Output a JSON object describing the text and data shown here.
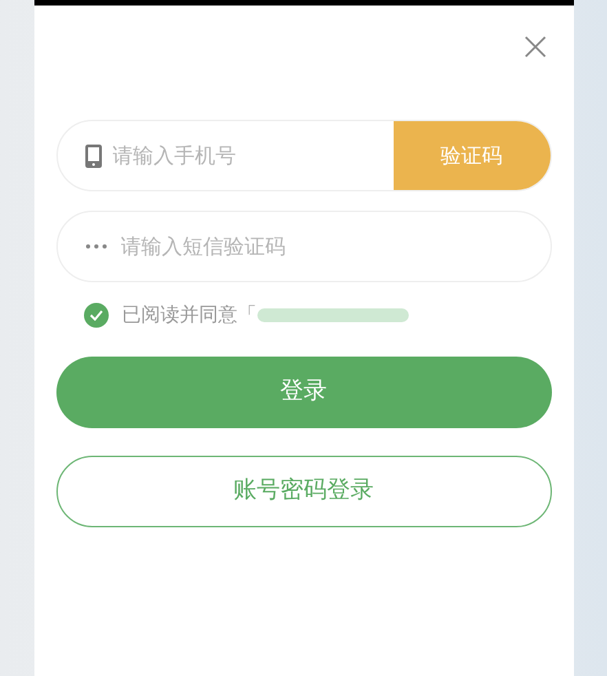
{
  "phone_field": {
    "placeholder": "请输入手机号"
  },
  "code_button": {
    "label": "验证码"
  },
  "sms_field": {
    "placeholder": "请输入短信验证码"
  },
  "agreement": {
    "checked": true,
    "text": "已阅读并同意「"
  },
  "login_button": {
    "label": "登录"
  },
  "password_login_button": {
    "label": "账号密码登录"
  }
}
